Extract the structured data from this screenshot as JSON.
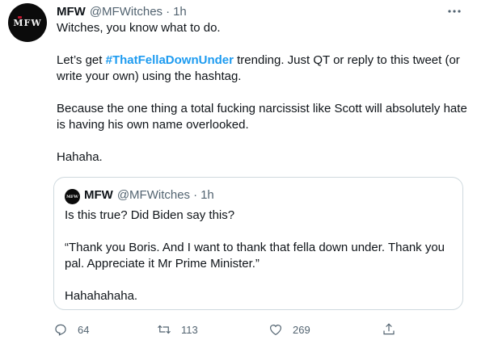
{
  "tweet": {
    "avatar_text": "MFW",
    "name": "MFW",
    "handle": "@MFWitches",
    "separator": "·",
    "time": "1h",
    "line1": "Witches, you know what to do.",
    "line2_before": "Let’s get ",
    "hashtag": "#ThatFellaDownUnder",
    "line2_after": " trending. Just QT or reply to this tweet (or write your own) using the hashtag.",
    "line3": "Because the one thing a total fucking narcissist like Scott will absolutely hate is having his own name overlooked.",
    "line4": "Hahaha."
  },
  "quote": {
    "avatar_text": "MFW",
    "name": "MFW",
    "handle": "@MFWitches",
    "separator": "·",
    "time": "1h",
    "line1": "Is this true? Did Biden say this?",
    "line2": "“Thank you Boris. And I want to thank that fella down under. Thank you pal. Appreciate it Mr Prime Minister.”",
    "line3": "Hahahahaha."
  },
  "actions": {
    "replies": "64",
    "retweets": "113",
    "likes": "269"
  },
  "icons": {
    "more": "more-options-icon",
    "reply": "reply-icon",
    "retweet": "retweet-icon",
    "like": "heart-icon",
    "share": "share-icon"
  },
  "colors": {
    "hashtag": "#1d9bf0",
    "muted": "#536471",
    "text": "#0f1419",
    "border": "#cfd9de"
  }
}
